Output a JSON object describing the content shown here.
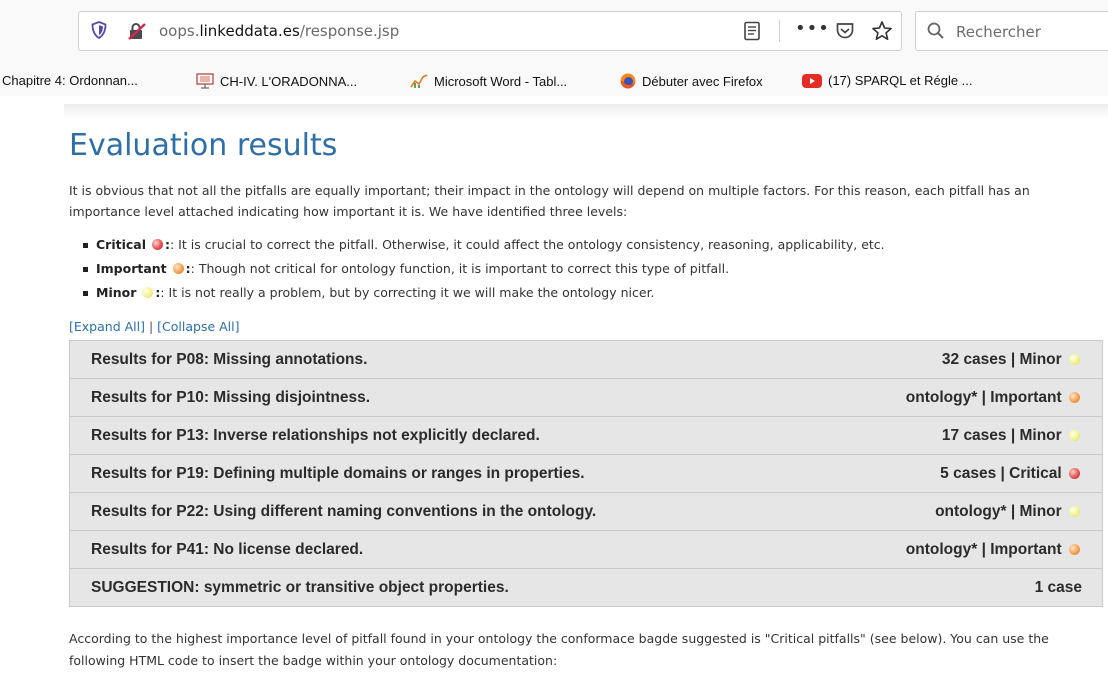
{
  "browser": {
    "url_prefix": "oops.",
    "url_host": "linkeddata.es",
    "url_path": "/response.jsp",
    "more_label": "•••",
    "search_placeholder": "Rechercher"
  },
  "bookmarks": [
    {
      "label": "Chapitre 4: Ordonnan...",
      "icon": "none"
    },
    {
      "label": "CH-IV. L'ORADONNA...",
      "icon": "presentation-icon"
    },
    {
      "label": "Microsoft Word - Tabl...",
      "icon": "chart-icon"
    },
    {
      "label": "Débuter avec Firefox",
      "icon": "firefox-icon"
    },
    {
      "label": "(17) SPARQL et Régle ...",
      "icon": "youtube-icon"
    }
  ],
  "page": {
    "title": "Evaluation results",
    "intro": "It is obvious that not all the pitfalls are equally important; their impact in the ontology will depend on multiple factors. For this reason, each pitfall has an importance level attached indicating how important it is. We have identified three levels:",
    "levels": [
      {
        "name": "Critical",
        "level": "critical",
        "text": ": It is crucial to correct the pitfall. Otherwise, it could affect the ontology consistency, reasoning, applicability, etc."
      },
      {
        "name": "Important",
        "level": "important",
        "text": ": Though not critical for ontology function, it is important to correct this type of pitfall."
      },
      {
        "name": "Minor",
        "level": "minor",
        "text": ": It is not really a problem, but by correcting it we will make the ontology nicer."
      }
    ],
    "expand_all": "[Expand All]",
    "separator": " | ",
    "collapse_all": "[Collapse All]",
    "results": [
      {
        "label": "Results for P08: Missing annotations.",
        "right": "32 cases | Minor",
        "level": "minor"
      },
      {
        "label": "Results for P10: Missing disjointness.",
        "right": "ontology* | Important",
        "level": "important"
      },
      {
        "label": "Results for P13: Inverse relationships not explicitly declared.",
        "right": "17 cases | Minor",
        "level": "minor"
      },
      {
        "label": "Results for P19: Defining multiple domains or ranges in properties.",
        "right": "5 cases | Critical",
        "level": "critical"
      },
      {
        "label": "Results for P22: Using different naming conventions in the ontology.",
        "right": "ontology* | Minor",
        "level": "minor"
      },
      {
        "label": "Results for P41: No license declared.",
        "right": "ontology* | Important",
        "level": "important"
      },
      {
        "label": "SUGGESTION: symmetric or transitive object properties.",
        "right": "1 case",
        "level": ""
      }
    ],
    "outro": "According to the highest importance level of pitfall found in your ontology the conformace bagde suggested is \"Critical pitfalls\" (see below). You can use the following HTML code to insert the badge within your ontology documentation:"
  },
  "colors": {
    "title": "#2d6fa6",
    "critical": "#e04a4a",
    "important": "#f09a4a",
    "minor": "#f1f08a"
  }
}
